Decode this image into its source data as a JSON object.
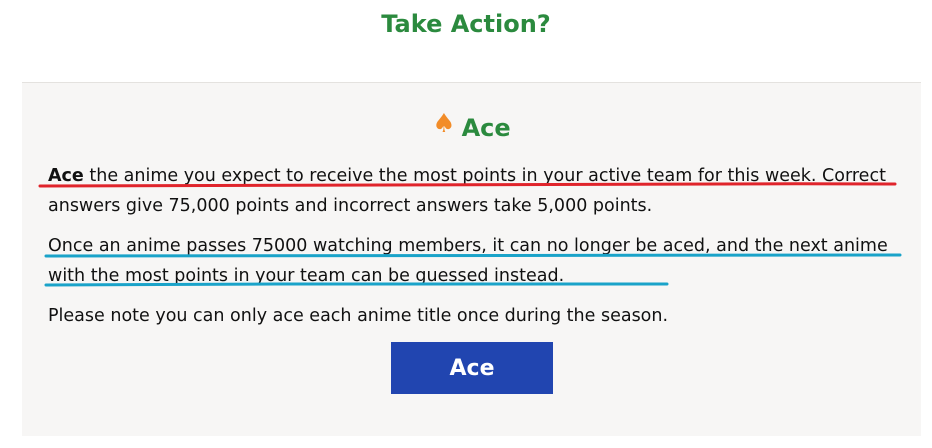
{
  "page": {
    "title": "Take Action?"
  },
  "section": {
    "icon": "spade-icon",
    "icon_glyph": "♠",
    "heading": "Ace",
    "intro_bold": "Ace",
    "intro_rest": " the anime you expect to receive the most points in your active team for this week. Correct answers give 75,000 points and incorrect answers take 5,000 points.",
    "rule_text": "Once an anime passes 75000 watching members, it can no longer be aced, and the next anime with the most points in your team can be guessed instead.",
    "note_text": "Please note you can only ace each anime title once during the season.",
    "button_label": "Ace"
  },
  "annotations": {
    "red_color": "#e0242b",
    "blue_color": "#1aa3c9"
  },
  "colors": {
    "title_green": "#2b8a3e",
    "icon_orange": "#f28c28",
    "button_blue": "#2145b0",
    "panel_bg": "#f7f6f5"
  }
}
